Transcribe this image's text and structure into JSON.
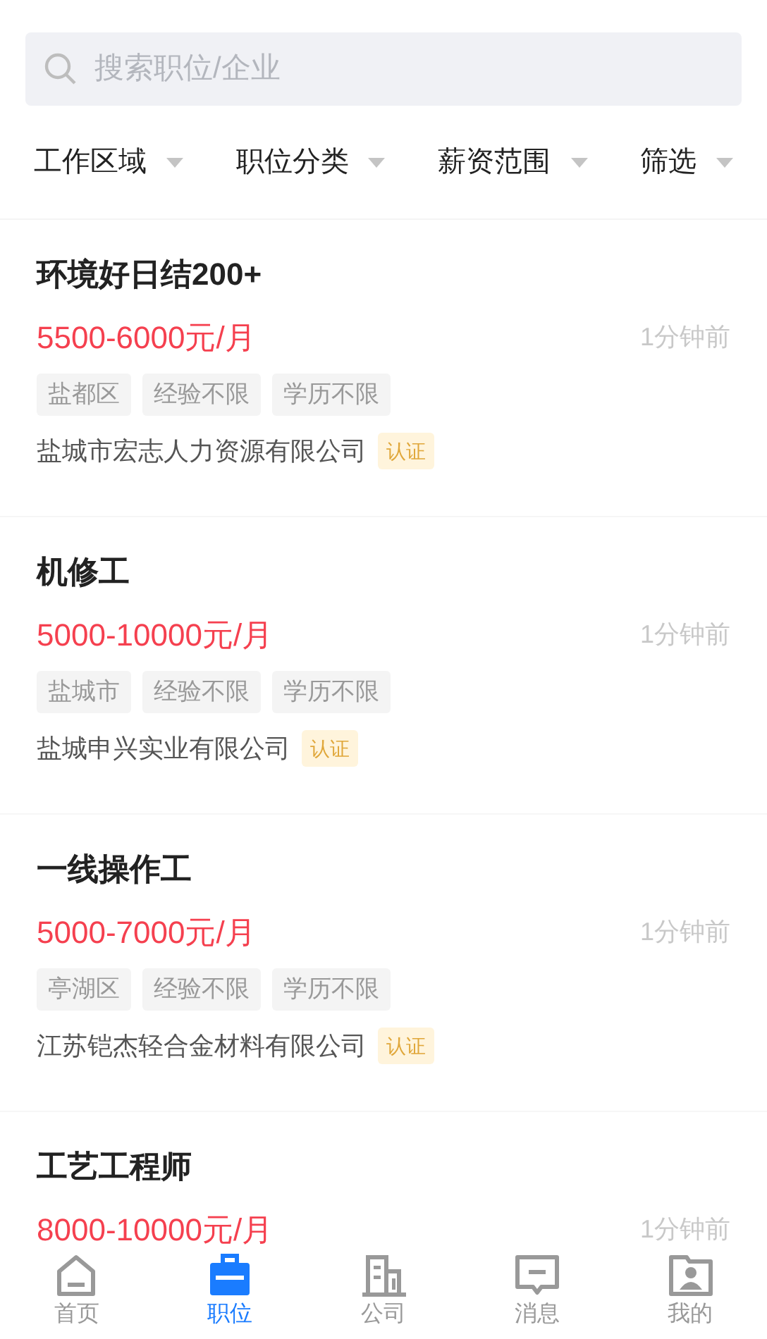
{
  "search": {
    "placeholder": "搜索职位/企业"
  },
  "filters": [
    {
      "label": "工作区域"
    },
    {
      "label": "职位分类"
    },
    {
      "label": "薪资范围"
    },
    {
      "label": "筛选"
    }
  ],
  "jobs": [
    {
      "title": "环境好日结200+",
      "salary": "5500-6000元/月",
      "time": "1分钟前",
      "tags": [
        "盐都区",
        "经验不限",
        "学历不限"
      ],
      "company": "盐城市宏志人力资源有限公司",
      "badge": "认证"
    },
    {
      "title": "机修工",
      "salary": "5000-10000元/月",
      "time": "1分钟前",
      "tags": [
        "盐城市",
        "经验不限",
        "学历不限"
      ],
      "company": "盐城申兴实业有限公司",
      "badge": "认证"
    },
    {
      "title": "一线操作工",
      "salary": "5000-7000元/月",
      "time": "1分钟前",
      "tags": [
        "亭湖区",
        "经验不限",
        "学历不限"
      ],
      "company": "江苏铠杰轻合金材料有限公司",
      "badge": "认证"
    },
    {
      "title": "工艺工程师",
      "salary": "8000-10000元/月",
      "time": "1分钟前"
    }
  ],
  "tabs": [
    {
      "label": "首页",
      "selected": false
    },
    {
      "label": "职位",
      "selected": true
    },
    {
      "label": "公司",
      "selected": false
    },
    {
      "label": "消息",
      "selected": false
    },
    {
      "label": "我的",
      "selected": false
    }
  ]
}
